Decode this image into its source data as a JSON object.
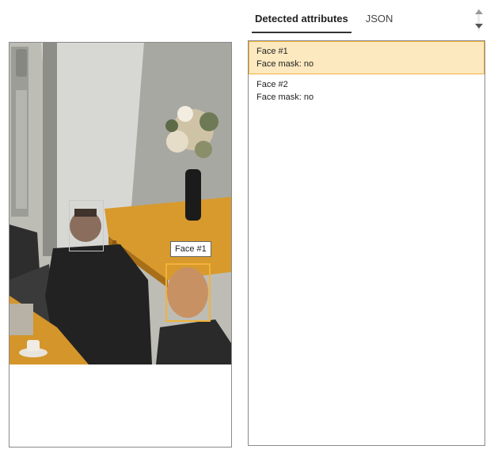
{
  "tabs": [
    {
      "label": "Detected attributes",
      "active": true
    },
    {
      "label": "JSON",
      "active": false
    }
  ],
  "faces": [
    {
      "title": "Face #1",
      "attribute": "Face mask: no",
      "selected": true
    },
    {
      "title": "Face #2",
      "attribute": "Face mask: no",
      "selected": false
    }
  ],
  "tooltip": {
    "label": "Face #1"
  },
  "colors": {
    "accent": "#f0b23a",
    "selected_bg": "#fde9bf"
  }
}
